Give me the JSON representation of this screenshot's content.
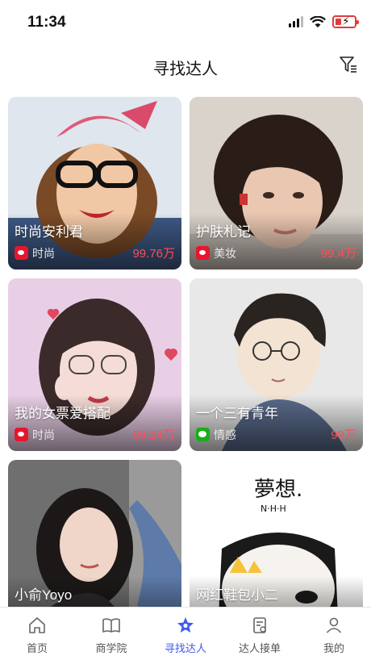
{
  "status": {
    "time": "11:34"
  },
  "header": {
    "title": "寻找达人"
  },
  "cards": [
    {
      "name": "时尚安利君",
      "category": "时尚",
      "fans": "99.76万",
      "platform": "weibo"
    },
    {
      "name": "护肤札记",
      "category": "美妆",
      "fans": "99.4万",
      "platform": "weibo"
    },
    {
      "name": "我的女票爱搭配",
      "category": "时尚",
      "fans": "99.24万",
      "platform": "weibo"
    },
    {
      "name": "一个三有青年",
      "category": "情感",
      "fans": "99万",
      "platform": "wechat"
    },
    {
      "name": "小俞Yoyo",
      "category": "",
      "fans": "",
      "platform": ""
    },
    {
      "name": "网红鞋包小二",
      "category": "",
      "fans": "",
      "platform": ""
    }
  ],
  "tabs": [
    {
      "label": "首页",
      "icon": "home-icon"
    },
    {
      "label": "商学院",
      "icon": "book-icon"
    },
    {
      "label": "寻找达人",
      "icon": "star-icon",
      "active": true
    },
    {
      "label": "达人接单",
      "icon": "order-icon"
    },
    {
      "label": "我的",
      "icon": "user-icon"
    }
  ],
  "colors": {
    "accent": "#3d5af1",
    "fans": "#ff4d5a",
    "weibo": "#e6162d",
    "wechat": "#1aad19"
  }
}
